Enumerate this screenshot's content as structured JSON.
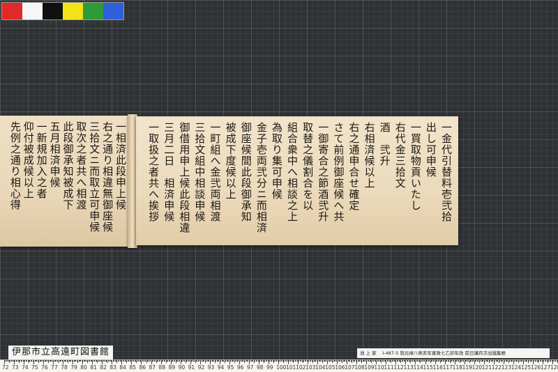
{
  "color_swatches": [
    {
      "name": "red",
      "color": "#e02a2a"
    },
    {
      "name": "white",
      "color": "#f6f6f6"
    },
    {
      "name": "black",
      "color": "#101010"
    },
    {
      "name": "yellow",
      "color": "#f2e21a"
    },
    {
      "name": "green",
      "color": "#2e9b3a"
    },
    {
      "name": "blue",
      "color": "#2f5fd8"
    }
  ],
  "library_label": "伊那市立高遠町図書館",
  "catalog_label": "池 上 家 　I-487-5 就元禄八癸亥年寛政七乙卯年改 前日講月次出銭集帳",
  "ruler": {
    "start": 72,
    "end": 128,
    "labels": [
      "72",
      "73",
      "74",
      "75",
      "76",
      "77",
      "78",
      "79",
      "80",
      "81",
      "82",
      "83",
      "84",
      "85",
      "86",
      "87",
      "88",
      "89",
      "90",
      "91",
      "92",
      "93",
      "94",
      "95",
      "96",
      "97",
      "98",
      "99",
      "100",
      "101",
      "102",
      "103",
      "104",
      "105",
      "106",
      "107",
      "108",
      "109",
      "110",
      "111",
      "112",
      "113",
      "114",
      "115",
      "116",
      "117",
      "118",
      "119",
      "120",
      "121",
      "122",
      "123",
      "124",
      "125",
      "126",
      "127",
      "128"
    ]
  },
  "manuscript_right_columns": [
    "一金代引替料壱弐拾",
    "出し可申候",
    "一買取物貢いたし",
    "右代金三拾文",
    "酒　弐升",
    "右相済候以上",
    "右之通申合せ確定",
    "さて前例御座候へ共",
    "一御寄合之節酒弐升",
    "取替之儀割合を以",
    "組合衆中へ相談之上",
    "為取り集可申候",
    "金子壱両弐分ニ而相済",
    "御座候間此段御承知",
    "被成下度候以上",
    "一町組へ金弐両相渡",
    "三拾文組中相談申候",
    "御借用申上候此段相違",
    "三月二日　相済申候",
    "一取扱之者共へ挨拶"
  ],
  "manuscript_left_columns": [
    "一相済此段申上候",
    "右之通り相違無御座候",
    "三拾文ニ而取立可申候",
    "取次之者共へ相渡",
    "此段御承知被成下",
    "五月相済申候",
    "一新規加入之者",
    "仰付被成候以上",
    "先例之通り相心得"
  ]
}
